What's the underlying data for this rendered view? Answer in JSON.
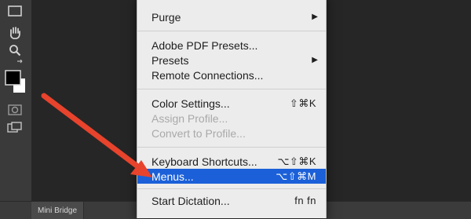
{
  "tools": [
    {
      "icon": "marquee-tool-icon"
    },
    {
      "icon": "hand-tool-icon"
    },
    {
      "icon": "zoom-tool-icon"
    },
    {
      "icon": "color-swatches-icon"
    },
    {
      "icon": "quick-mask-icon"
    },
    {
      "icon": "screen-mode-icon"
    }
  ],
  "panel": {
    "mini_bridge_label": "Mini Bridge"
  },
  "menu": {
    "purge": "Purge",
    "adobe_pdf_presets": "Adobe PDF Presets...",
    "presets": "Presets",
    "remote_connections": "Remote Connections...",
    "color_settings": "Color Settings...",
    "color_settings_shortcut": "⇧⌘K",
    "assign_profile": "Assign Profile...",
    "convert_to_profile": "Convert to Profile...",
    "keyboard_shortcuts": "Keyboard Shortcuts...",
    "keyboard_shortcuts_shortcut": "⌥⇧⌘K",
    "menus": "Menus...",
    "menus_shortcut": "⌥⇧⌘M",
    "start_dictation": "Start Dictation...",
    "start_dictation_shortcut": "fn fn"
  },
  "colors": {
    "highlight": "#1b60d8",
    "annotation_arrow": "#e8432c",
    "menu_bg": "#ececec"
  }
}
